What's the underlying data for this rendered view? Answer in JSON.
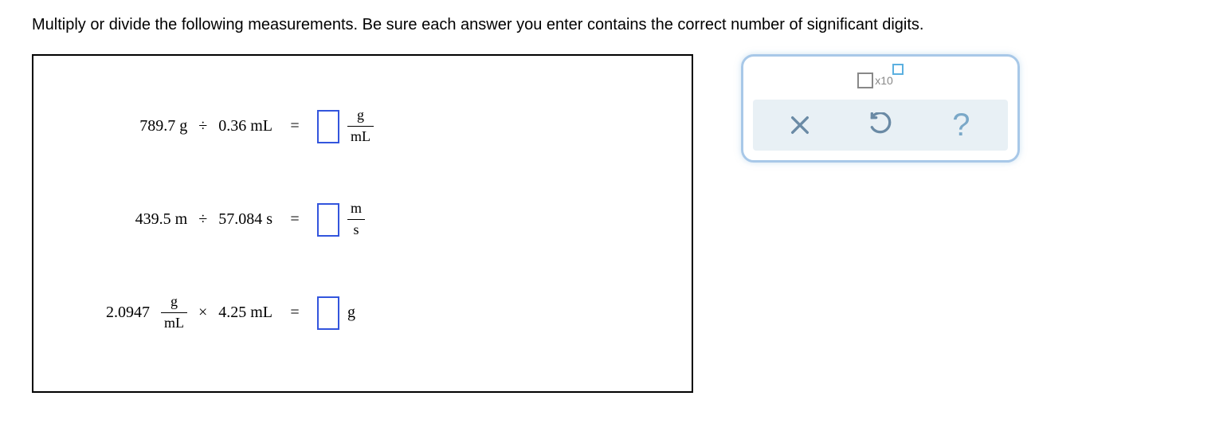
{
  "instructions": "Multiply or divide the following measurements. Be sure each answer you enter contains the correct number of significant digits.",
  "problems": [
    {
      "lhs_parts": [
        "789.7 g",
        "÷",
        "0.36 mL"
      ],
      "unit_numer": "g",
      "unit_denom": "mL",
      "result_type": "fraction"
    },
    {
      "lhs_parts": [
        "439.5 m",
        "÷",
        "57.084 s"
      ],
      "unit_numer": "m",
      "unit_denom": "s",
      "result_type": "fraction"
    },
    {
      "lhs_value": "2.0947",
      "lhs_frac_numer": "g",
      "lhs_frac_denom": "mL",
      "lhs_op": "×",
      "lhs_second": "4.25 mL",
      "unit_single": "g",
      "result_type": "single"
    }
  ],
  "toolbox": {
    "sci_label": "x10"
  }
}
